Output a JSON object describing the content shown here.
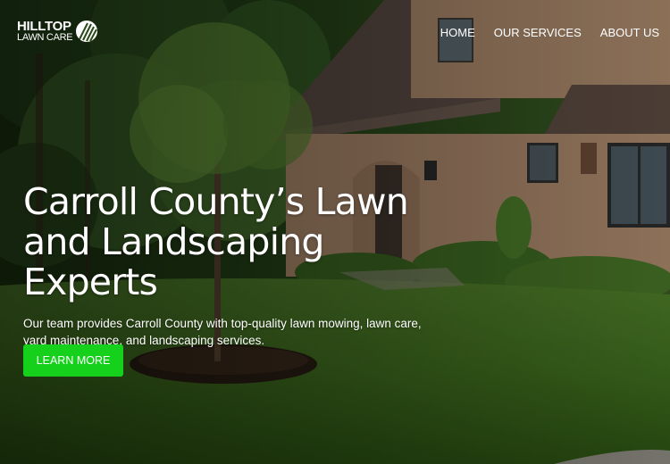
{
  "brand": {
    "line1": "HILLTOP",
    "line2": "LAWN CARE",
    "logo_icon": "leaf-stripes-icon"
  },
  "nav": {
    "items": [
      {
        "label": "HOME"
      },
      {
        "label": "OUR SERVICES"
      },
      {
        "label": "ABOUT US"
      }
    ]
  },
  "hero": {
    "title_line1": "Carroll County’s Lawn",
    "title_line2": "and Landscaping Experts",
    "description": "Our team provides Carroll County with top-quality lawn mowing, lawn care, yard maintenance, and landscaping services.",
    "cta_label": "LEARN MORE",
    "background_image": "house-with-green-lawn-photo"
  },
  "colors": {
    "cta": "#16d11c",
    "text": "#ffffff"
  }
}
